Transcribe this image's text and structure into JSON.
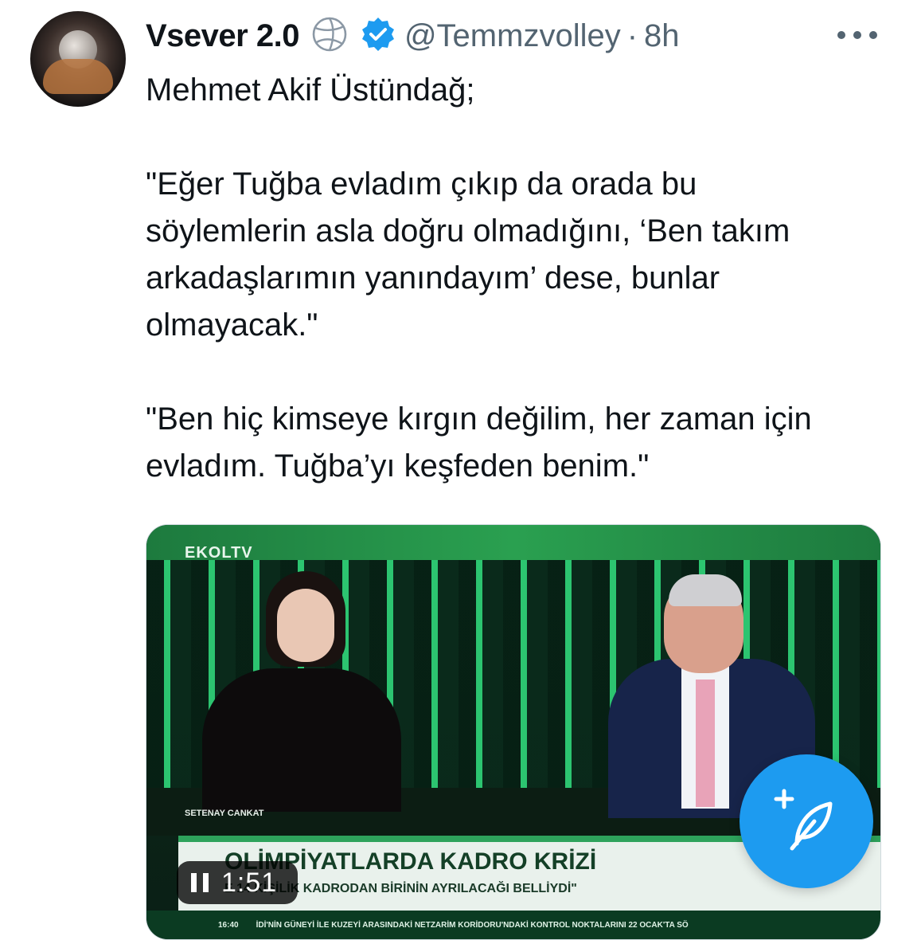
{
  "post": {
    "display_name": "Vsever 2.0",
    "handle": "@Temmzvolley",
    "separator": "·",
    "timestamp": "8h",
    "paragraphs": [
      "Mehmet Akif Üstündağ;",
      "\"Eğer Tuğba evladım çıkıp da orada bu söylemlerin asla doğru olmadığını, ‘Ben takım arkadaşlarımın yanındayım’ dese, bunlar olmayacak.\"",
      "\"Ben hiç kimseye kırgın değilim, her zaman için evladım. Tuğba’yı keşfeden benim.\""
    ],
    "icons": {
      "volleyball": "volleyball-icon",
      "verified": "verified-badge-icon",
      "more": "more-icon"
    },
    "colors": {
      "verified": "#1d9bf0",
      "secondary_text": "#536471",
      "fab": "#1d9bf0"
    }
  },
  "video": {
    "channel_logo": "EKOLTV",
    "person_caption": "SETENAY CANKAT",
    "headline": "OLİMPİYATLARDA KADRO KRİZİ",
    "subheadline": "E 14 KİŞİLİK KADRODAN BİRİNİN AYRILACAĞI BELLİYDİ\"",
    "ticker_time": "16:40",
    "ticker_text": "İDİ'NİN GÜNEYİ İLE KUZEYİ ARASINDAKİ NETZARİM KORİDORU'NDAKİ KONTROL NOKTALARINI 22 OCAK'TA SÖ",
    "duration": "1:51",
    "state_icon": "pause-icon"
  },
  "fab": {
    "icon": "compose-post-icon"
  }
}
